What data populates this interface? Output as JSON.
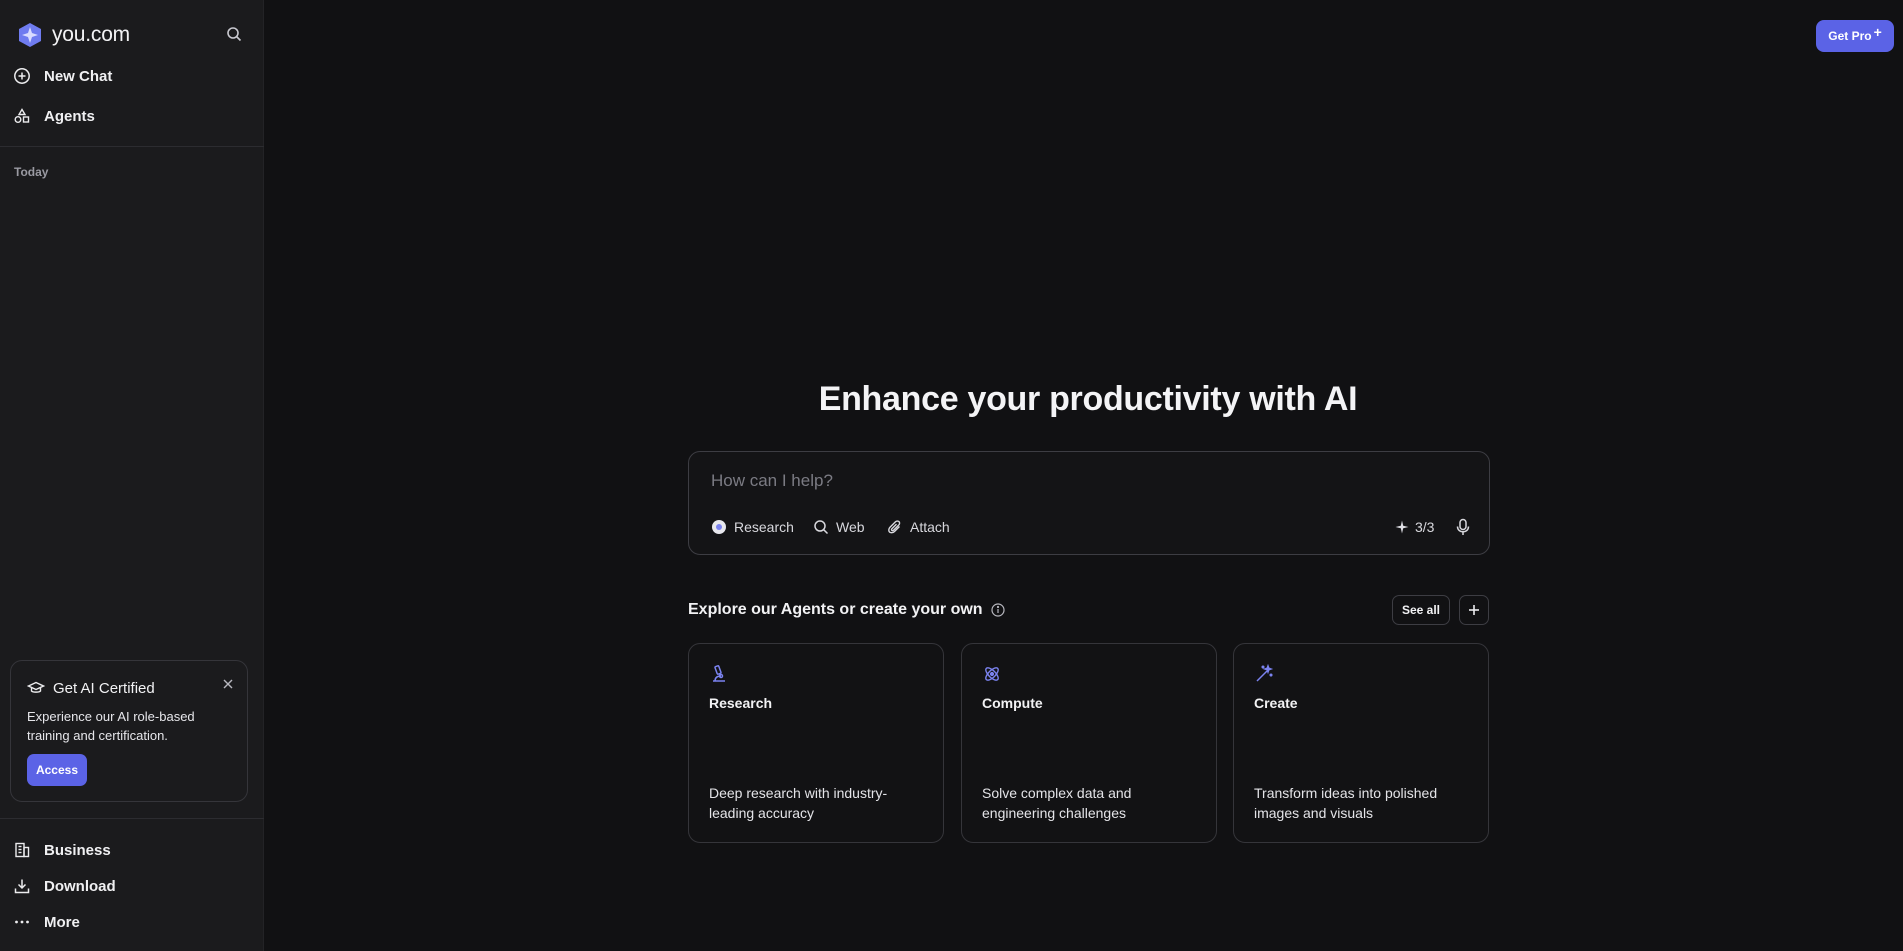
{
  "sidebar": {
    "brand": "you.com",
    "search_icon": "search-icon",
    "nav": [
      {
        "label": "New Chat",
        "icon": "plus-circle-icon"
      },
      {
        "label": "Agents",
        "icon": "shapes-icon"
      }
    ],
    "section_today": "Today",
    "promo": {
      "title": "Get AI Certified",
      "text": "Experience our AI role-based training and certification.",
      "button": "Access"
    },
    "bottom": [
      {
        "label": "Business",
        "icon": "building-icon"
      },
      {
        "label": "Download",
        "icon": "download-icon"
      },
      {
        "label": "More",
        "icon": "more-dots-icon"
      }
    ]
  },
  "header": {
    "get_pro": "Get Pro",
    "get_pro_plus": "+"
  },
  "main": {
    "headline": "Enhance your productivity with AI",
    "prompt": {
      "placeholder": "How can I help?",
      "chips": [
        "Research",
        "Web",
        "Attach"
      ],
      "counter": "3/3"
    },
    "explore": {
      "title": "Explore our Agents or create your own",
      "see_all": "See all"
    },
    "cards": [
      {
        "title": "Research",
        "desc": "Deep research with industry-leading accuracy",
        "icon": "microscope-icon"
      },
      {
        "title": "Compute",
        "desc": "Solve complex data and engineering challenges",
        "icon": "atom-icon"
      },
      {
        "title": "Create",
        "desc": "Transform ideas into polished images and visuals",
        "icon": "magic-wand-icon"
      }
    ]
  },
  "colors": {
    "accent": "#5b63e6",
    "background": "#111113",
    "sidebar": "#1b1b1d"
  }
}
